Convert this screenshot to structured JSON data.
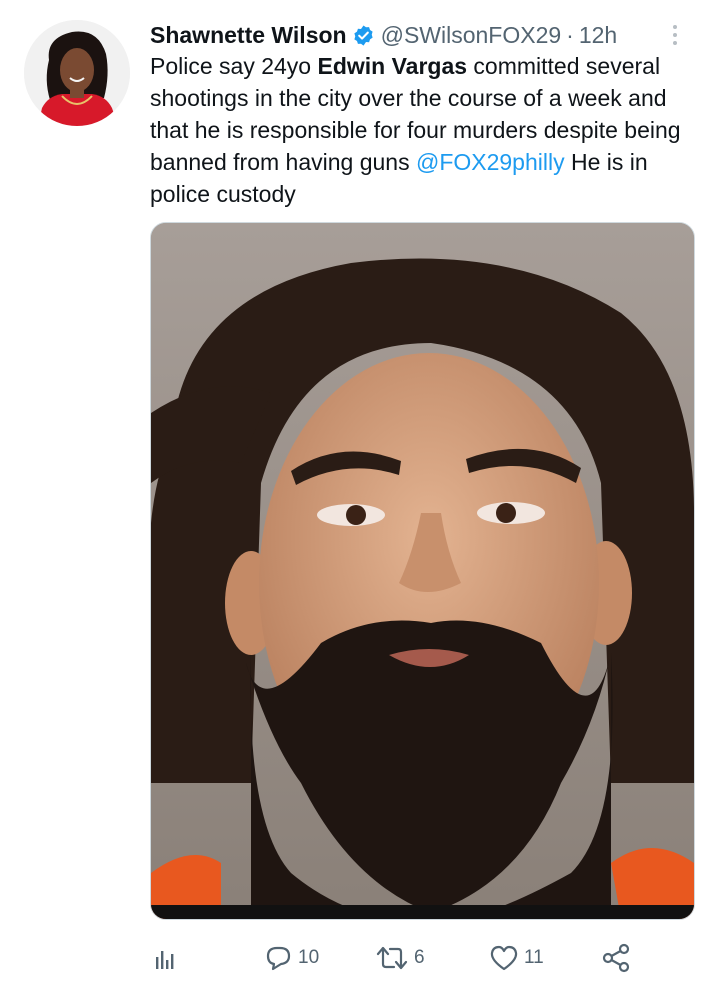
{
  "tweet": {
    "author_name": "Shawnette Wilson",
    "handle": "@SWilsonFOX29",
    "separator": "·",
    "time": "12h",
    "text_part1": "Police say 24yo ",
    "text_bold": "Edwin Vargas",
    "text_part2": " committed several shootings in the city over the course of a week and that he is responsible for four murders despite being banned from having guns ",
    "mention": "@FOX29philly",
    "text_part3": " He is in police custody"
  },
  "actions": {
    "analytics_icon": "bar-chart-icon",
    "replies": "10",
    "retweets": "6",
    "likes": "11",
    "share_icon": "share-icon"
  },
  "colors": {
    "text": "#0f1419",
    "muted": "#536471",
    "link": "#1d9bf0",
    "verified": "#1d9bf0",
    "avatar_dress": "#d7192a",
    "jumpsuit": "#e8581f"
  }
}
